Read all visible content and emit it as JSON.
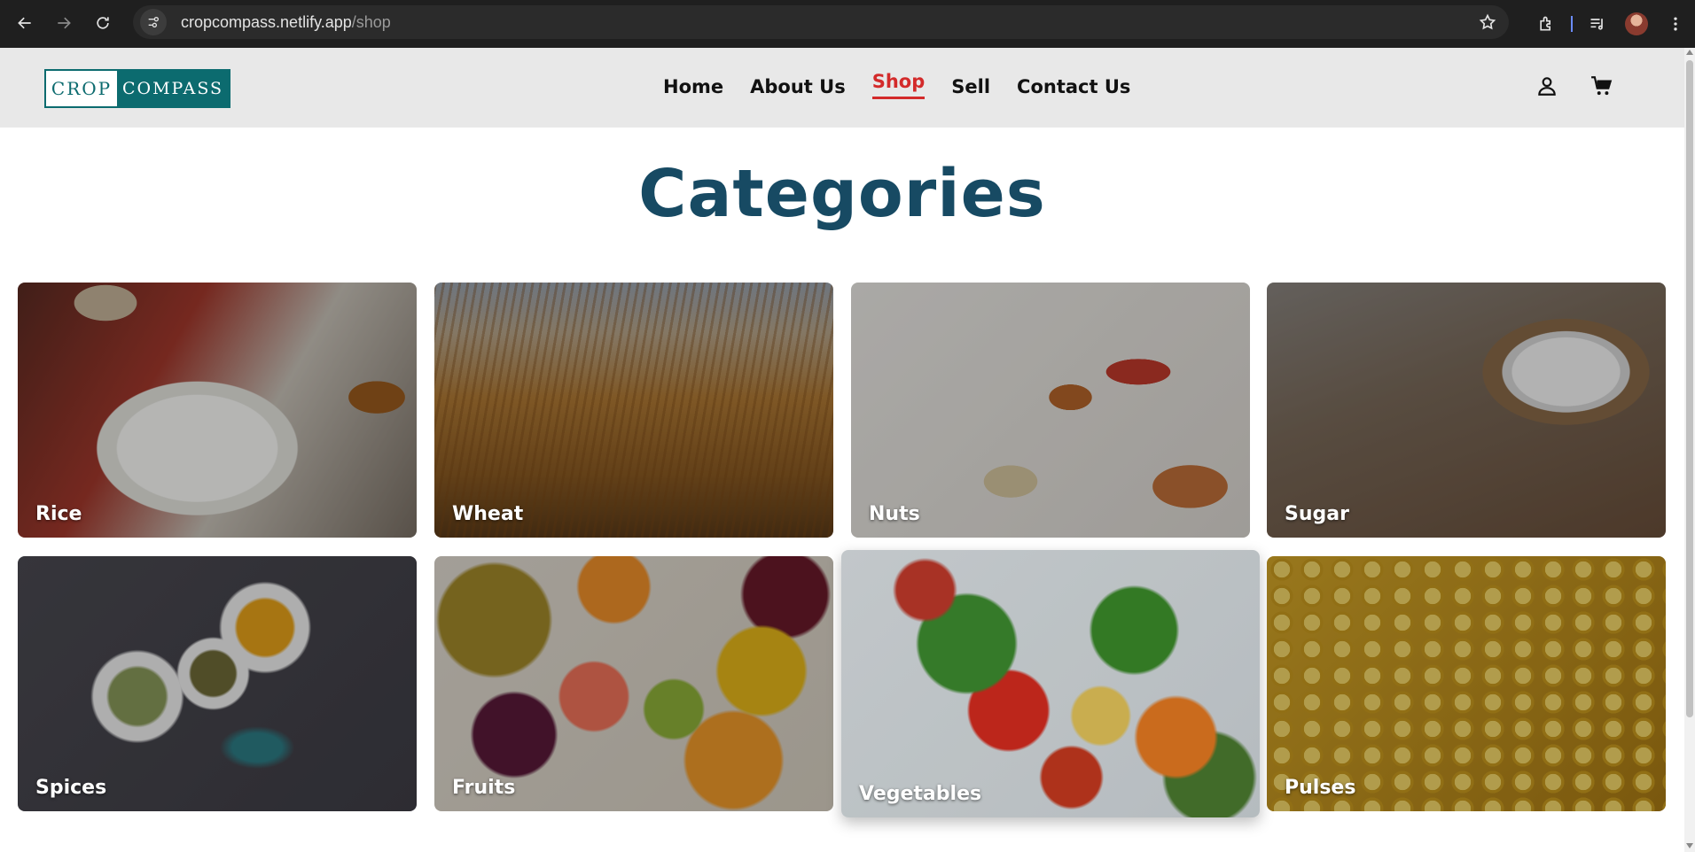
{
  "browser": {
    "url_host": "cropcompass.netlify.app",
    "url_path": "/shop"
  },
  "header": {
    "logo_left": "CROP",
    "logo_right": "COMPASS",
    "nav": [
      {
        "label": "Home"
      },
      {
        "label": "About Us"
      },
      {
        "label": "Shop",
        "active": true
      },
      {
        "label": "Sell"
      },
      {
        "label": "Contact Us"
      }
    ],
    "icons": [
      "user-icon",
      "cart-icon"
    ],
    "active_color": "#d32a2a"
  },
  "page": {
    "title": "Categories",
    "title_color": "#174a63"
  },
  "categories": [
    {
      "label": "Rice"
    },
    {
      "label": "Wheat"
    },
    {
      "label": "Nuts"
    },
    {
      "label": "Sugar"
    },
    {
      "label": "Spices"
    },
    {
      "label": "Fruits"
    },
    {
      "label": "Vegetables",
      "hovered": true
    },
    {
      "label": "Pulses"
    }
  ]
}
